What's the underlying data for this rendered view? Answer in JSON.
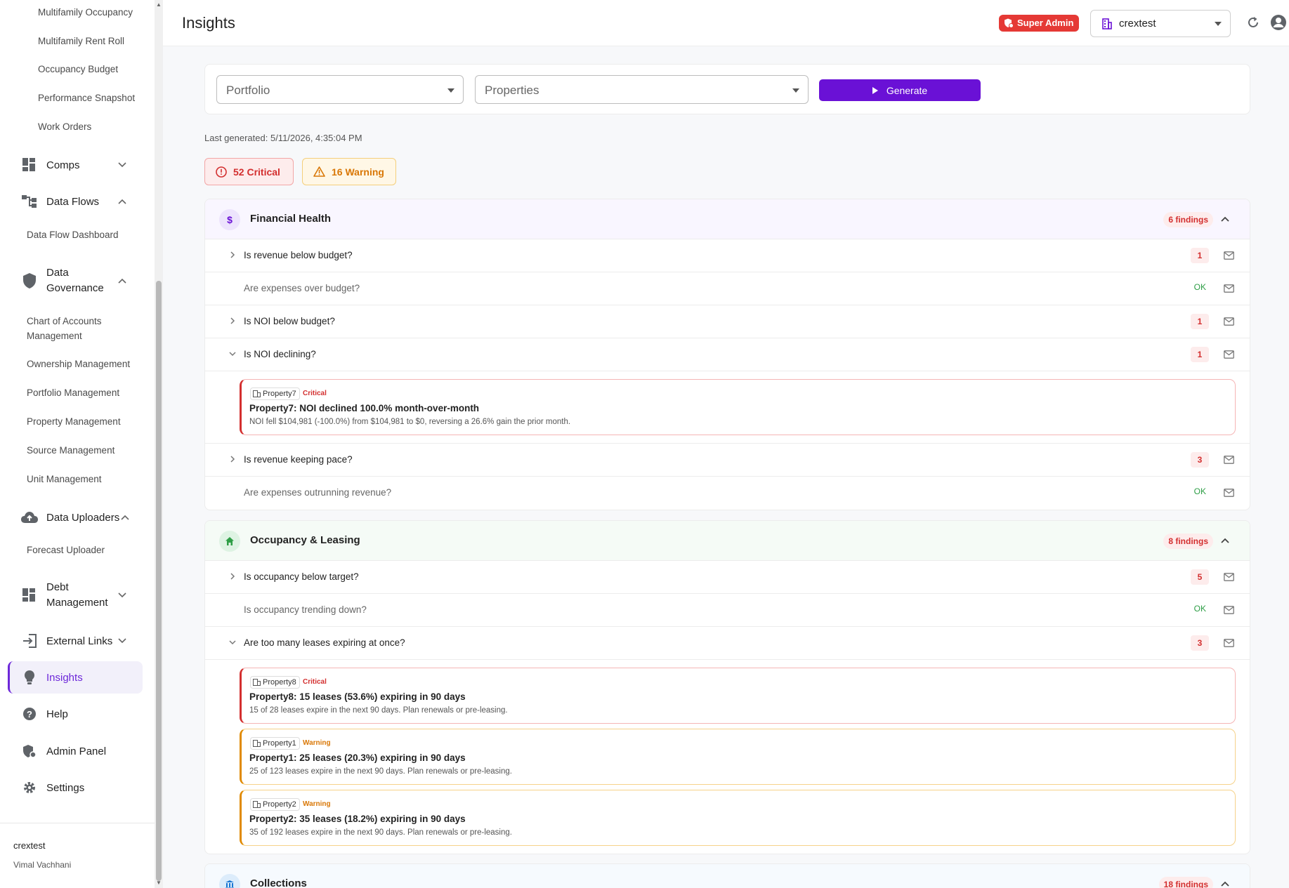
{
  "sidebar": {
    "sub_items_top": [
      "Multifamily Occupancy",
      "Multifamily Rent Roll",
      "Occupancy Budget",
      "Performance Snapshot",
      "Work Orders"
    ],
    "groups": {
      "comps": "Comps",
      "data_flows": "Data Flows",
      "data_governance": "Data\nGovernance",
      "data_uploaders": "Data Uploaders",
      "debt_management": "Debt\nManagement",
      "external_links": "External Links",
      "insights": "Insights",
      "help": "Help",
      "admin_panel": "Admin Panel",
      "settings": "Settings"
    },
    "data_flow_items": [
      "Data Flow Dashboard"
    ],
    "governance_items": [
      "Chart of Accounts Management",
      "Ownership Management",
      "Portfolio Management",
      "Property Management",
      "Source Management",
      "Unit Management"
    ],
    "uploader_items": [
      "Forecast Uploader"
    ],
    "footer": {
      "tenant": "crextest",
      "user": "Vimal Vachhani"
    }
  },
  "header": {
    "title": "Insights",
    "badge": "Super Admin",
    "tenant": "crextest"
  },
  "filters": {
    "portfolio_placeholder": "Portfolio",
    "properties_placeholder": "Properties",
    "generate_label": "Generate"
  },
  "last_generated": "Last generated: 5/11/2026, 4:35:04 PM",
  "summary": {
    "critical": "52 Critical",
    "warning": "16 Warning"
  },
  "sections": [
    {
      "title": "Financial Health",
      "findings": "6 findings",
      "questions": [
        {
          "text": "Is revenue below budget?",
          "count": "1"
        },
        {
          "text": "Are expenses over budget?",
          "status": "OK"
        },
        {
          "text": "Is NOI below budget?",
          "count": "1"
        },
        {
          "text": "Is NOI declining?",
          "count": "1"
        },
        {
          "text": "Is revenue keeping pace?",
          "count": "3"
        },
        {
          "text": "Are expenses outrunning revenue?",
          "status": "OK"
        }
      ],
      "details": [
        {
          "property": "Property7",
          "severity": "Critical",
          "title": "Property7: NOI declined 100.0% month-over-month",
          "desc": "NOI fell $104,981 (-100.0%) from $104,981 to $0, reversing a 26.6% gain the prior month."
        }
      ]
    },
    {
      "title": "Occupancy & Leasing",
      "findings": "8 findings",
      "questions": [
        {
          "text": "Is occupancy below target?",
          "count": "5"
        },
        {
          "text": "Is occupancy trending down?",
          "status": "OK"
        },
        {
          "text": "Are too many leases expiring at once?",
          "count": "3"
        }
      ],
      "details": [
        {
          "property": "Property8",
          "severity": "Critical",
          "title": "Property8: 15 leases (53.6%) expiring in 90 days",
          "desc": "15 of 28 leases expire in the next 90 days. Plan renewals or pre-leasing."
        },
        {
          "property": "Property1",
          "severity": "Warning",
          "title": "Property1: 25 leases (20.3%) expiring in 90 days",
          "desc": "25 of 123 leases expire in the next 90 days. Plan renewals or pre-leasing."
        },
        {
          "property": "Property2",
          "severity": "Warning",
          "title": "Property2: 35 leases (18.2%) expiring in 90 days",
          "desc": "35 of 192 leases expire in the next 90 days. Plan renewals or pre-leasing."
        }
      ]
    },
    {
      "title": "Collections",
      "findings": "18 findings"
    }
  ],
  "colors": {
    "accent": "#6a11d6",
    "critical": "#d32f2f",
    "warning": "#d97706",
    "ok": "#2e9e46"
  }
}
